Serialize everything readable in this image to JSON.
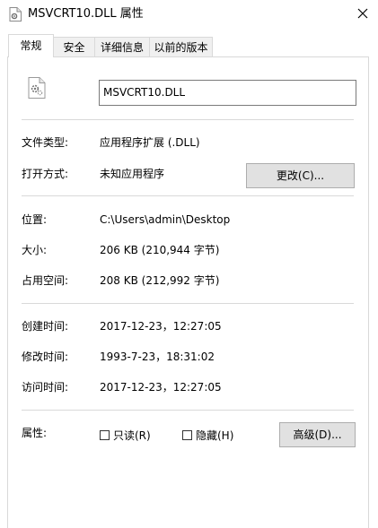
{
  "window": {
    "title": "MSVCRT10.DLL 属性",
    "close_glyph": "✕"
  },
  "tabs": [
    {
      "label": "常规",
      "active": true
    },
    {
      "label": "安全",
      "active": false
    },
    {
      "label": "详细信息",
      "active": false
    },
    {
      "label": "以前的版本",
      "active": false
    }
  ],
  "general": {
    "file_name": "MSVCRT10.DLL",
    "file_type_label": "文件类型:",
    "file_type_value": "应用程序扩展 (.DLL)",
    "opens_with_label": "打开方式:",
    "opens_with_value": "未知应用程序",
    "change_button": "更改(C)...",
    "location_label": "位置:",
    "location_value": "C:\\Users\\admin\\Desktop",
    "size_label": "大小:",
    "size_value": "206 KB (210,944 字节)",
    "size_on_disk_label": "占用空间:",
    "size_on_disk_value": "208 KB (212,992 字节)",
    "created_label": "创建时间:",
    "created_value": "2017-12-23，12:27:05",
    "modified_label": "修改时间:",
    "modified_value": "1993-7-23，18:31:02",
    "accessed_label": "访问时间:",
    "accessed_value": "2017-12-23，12:27:05",
    "attributes_label": "属性:",
    "readonly_label": "只读(R)",
    "readonly_checked": false,
    "hidden_label": "隐藏(H)",
    "hidden_checked": false,
    "advanced_button": "高级(D)..."
  }
}
